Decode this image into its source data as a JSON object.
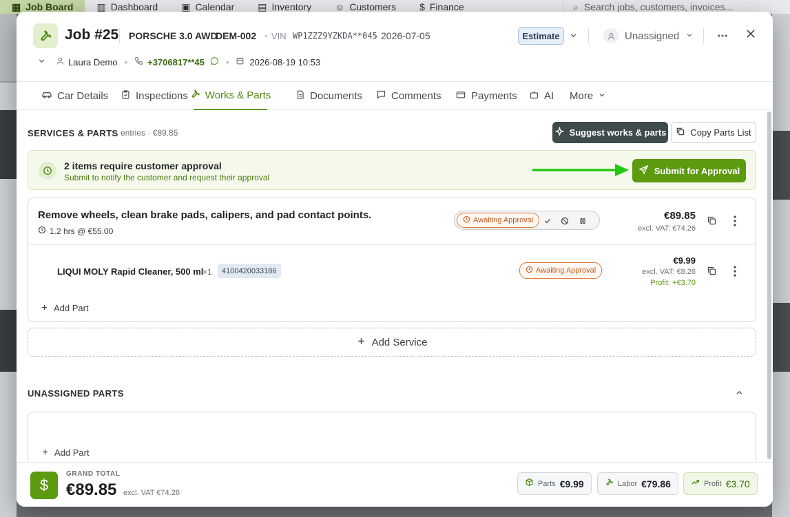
{
  "background_app": {
    "nav": [
      "Job Board",
      "Dashboard",
      "Calendar",
      "Inventory",
      "Customers",
      "Finance"
    ],
    "search_placeholder": "Search jobs, customers, invoices..."
  },
  "job": {
    "title": "Job #25",
    "car": "PORSCHE 3.0 AWD",
    "plate": "DEM-002",
    "vin_label": "VIN",
    "vin": "WP1ZZZ9YZKDA**045",
    "date": "2026-07-05",
    "status": "Estimate",
    "assignee": "Unassigned",
    "customer": "Laura Demo",
    "phone": "+3706817**45",
    "datetime": "2026-08-19 10:53"
  },
  "tabs": [
    {
      "label": "Car Details",
      "icon": "car-icon"
    },
    {
      "label": "Inspections",
      "icon": "clipboard-icon"
    },
    {
      "label": "Works & Parts",
      "icon": "wrench-icon",
      "active": true
    },
    {
      "label": "Documents",
      "icon": "document-icon"
    },
    {
      "label": "Comments",
      "icon": "comment-icon"
    },
    {
      "label": "Payments",
      "icon": "card-icon"
    },
    {
      "label": "AI",
      "icon": "robot-icon"
    },
    {
      "label": "More",
      "icon": "chevron-down-icon"
    }
  ],
  "services": {
    "title": "SERVICES & PARTS",
    "meta": "1 entries · €89.85",
    "suggest_label": "Suggest works & parts",
    "copy_label": "Copy Parts List"
  },
  "approval": {
    "title": "2 items require customer approval",
    "subtitle": "Submit to notify the customer and request their approval",
    "submit_label": "Submit for Approval"
  },
  "service_item": {
    "name": "Remove wheels, clean brake pads, calipers, and pad contact points.",
    "time": "1.2 hrs @ €55.00",
    "status": "Awaiting Approval",
    "price": "€89.85",
    "excl_vat": "excl. VAT: €74.26"
  },
  "part_item": {
    "name": "LIQUI MOLY Rapid Cleaner, 500 ml",
    "qty": "×1",
    "code": "4100420033186",
    "status": "Awaiting Approval",
    "price": "€9.99",
    "excl_vat": "excl. VAT: €8.26",
    "profit": "Profit: +€3.70"
  },
  "add_part_label": "Add Part",
  "add_service_label": "Add Service",
  "unassigned": {
    "title": "UNASSIGNED PARTS",
    "add_part_label": "Add Part"
  },
  "footer": {
    "grand_total_label": "GRAND TOTAL",
    "grand_total": "€89.85",
    "excl_vat": "excl. VAT €74.26",
    "parts_label": "Parts",
    "parts_value": "€9.99",
    "labor_label": "Labor",
    "labor_value": "€79.86",
    "profit_label": "Profit",
    "profit_value": "€3.70"
  },
  "colors": {
    "accent": "#5c9a10",
    "status_orange": "#e07b3b",
    "dark_button": "#3f4a4d"
  }
}
